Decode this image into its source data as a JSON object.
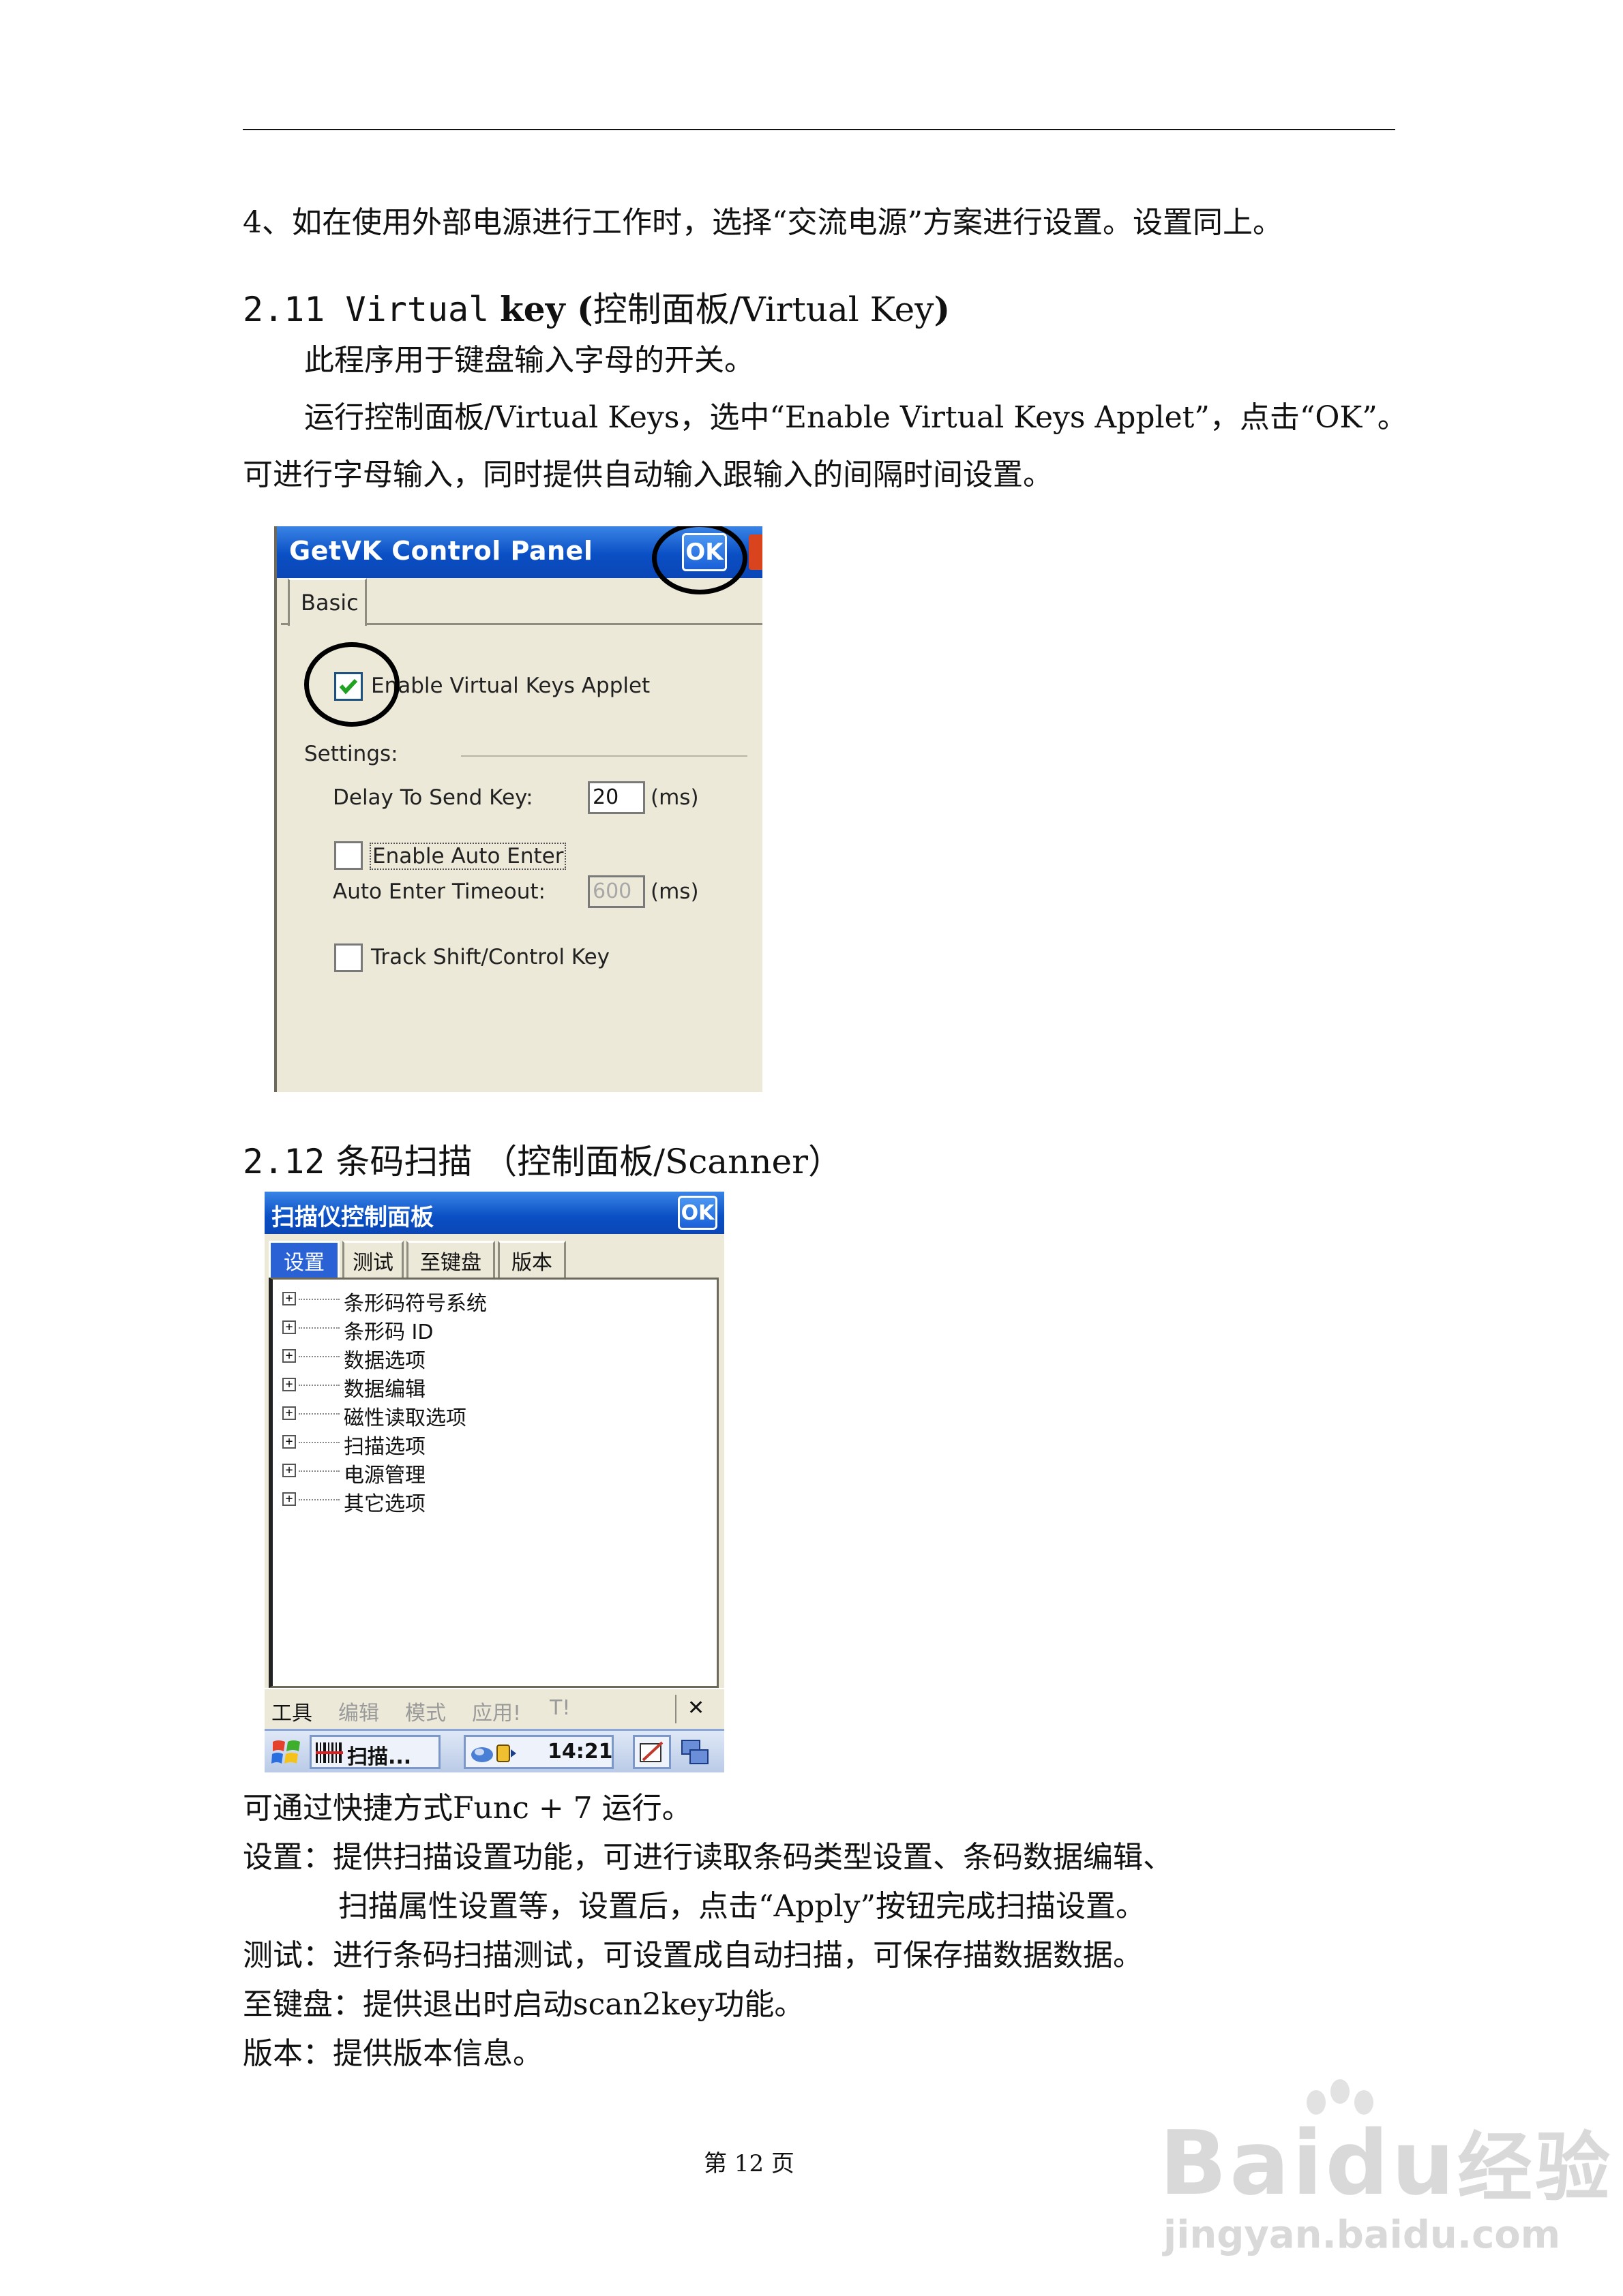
{
  "doc": {
    "line_4": "4、如在使用外部电源进行工作时，选择“交流电源”方案进行设置。设置同上。",
    "h211_num": "2.11 Virtual",
    "h211_key": "key (",
    "h211_rest": "控制面板/Virtual Key",
    "h211_close": ")",
    "p1": "此程序用于键盘输入字母的开关。",
    "p2": "运行控制面板/Virtual Keys，选中“Enable Virtual Keys Applet”，点击“OK”。",
    "p3": "可进行字母输入，同时提供自动输入跟输入的间隔时间设置。",
    "h212_num": "2.12",
    "h212_text": "条码扫描 （控制面板/Scanner）",
    "p4": "可通过快捷方式Func + 7 运行。",
    "p5": "设置：提供扫描设置功能，可进行读取条码类型设置、条码数据编辑、",
    "p6": "扫描属性设置等，设置后，点击“Apply”按钮完成扫描设置。",
    "p7": "测试：进行条码扫描测试，可设置成自动扫描，可保存描数据数据。",
    "p8": "至键盘：提供退出时启动scan2key功能。",
    "p9": "版本：提供版本信息。",
    "page_number": "第 12 页"
  },
  "getvk": {
    "title": "GetVK Control Panel",
    "ok": "OK",
    "tab": "Basic",
    "enable_label": "Enable Virtual Keys Applet",
    "enable_checked": true,
    "settings_label": "Settings:",
    "delay_label": "Delay To Send Key:",
    "delay_value": "20",
    "ms1": "(ms)",
    "auto_enter_label": "Enable Auto Enter",
    "auto_enter_checked": false,
    "timeout_label": "Auto Enter Timeout:",
    "timeout_value": "600",
    "ms2": "(ms)",
    "track_label": "Track Shift/Control Key",
    "track_checked": false
  },
  "scanner": {
    "title": "扫描仪控制面板",
    "ok": "OK",
    "tabs": [
      "设置",
      "测试",
      "至键盘",
      "版本"
    ],
    "tree": [
      "条形码符号系统",
      "条形码 ID",
      "数据选项",
      "数据编辑",
      "磁性读取选项",
      "扫描选项",
      "电源管理",
      "其它选项"
    ],
    "menu": [
      "工具",
      "编辑",
      "模式",
      "应用!",
      "T!"
    ],
    "menu_close": "✕",
    "task_app": "扫描...",
    "clock": "14:21"
  },
  "watermark": {
    "brand": "Bai",
    "brand2": "du",
    "product": "经验",
    "url": "jingyan.baidu.com"
  }
}
